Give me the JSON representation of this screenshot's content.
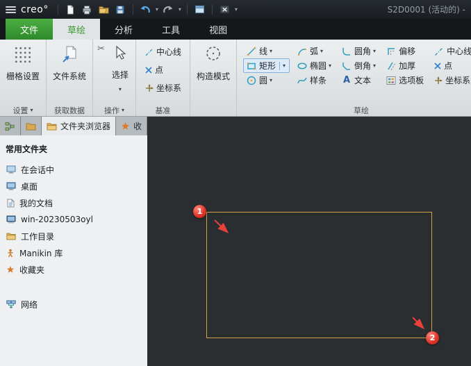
{
  "icons": {
    "chevron_down": "▾",
    "scissors": "✂",
    "text_glyph": "A"
  },
  "titlebar": {
    "logo": "creo°",
    "doc_title": "S2D0001 (活动的) -"
  },
  "menu_tabs": {
    "file": "文件",
    "sketch": "草绘",
    "analysis": "分析",
    "tools": "工具",
    "view": "视图"
  },
  "ribbon": {
    "grid_settings": "栅格设置",
    "settings_group": "设置",
    "file_system": "文件系统",
    "get_data_group": "获取数据",
    "select": "选择",
    "operations_group": "操作",
    "datum": {
      "centerline": "中心线",
      "point": "点",
      "csys": "坐标系",
      "group": "基准"
    },
    "construction_mode": "构造模式",
    "sketch": {
      "line": "线",
      "arc": "弧",
      "fillet": "圆角",
      "offset": "偏移",
      "centerline": "中心线",
      "rectangle": "矩形",
      "ellipse": "椭圆",
      "chamfer": "倒角",
      "thicken": "加厚",
      "point": "点",
      "circle": "圆",
      "spline": "样条",
      "text": "文本",
      "palette": "选项板",
      "csys": "坐标系",
      "group": "草绘"
    }
  },
  "sidebar": {
    "browser_tab": "文件夹浏览器",
    "favorites_tab": "收",
    "header": "常用文件夹",
    "items": [
      "在会话中",
      "桌面",
      "我的文档",
      "win-20230503oyl",
      "工作目录",
      "Manikin 库",
      "收藏夹",
      "网络"
    ]
  },
  "canvas": {
    "marker1": "1",
    "marker2": "2"
  },
  "colors": {
    "accent_green": "#3c9a30",
    "sketch_line": "#d4a349",
    "marker_red": "#e8403a"
  }
}
